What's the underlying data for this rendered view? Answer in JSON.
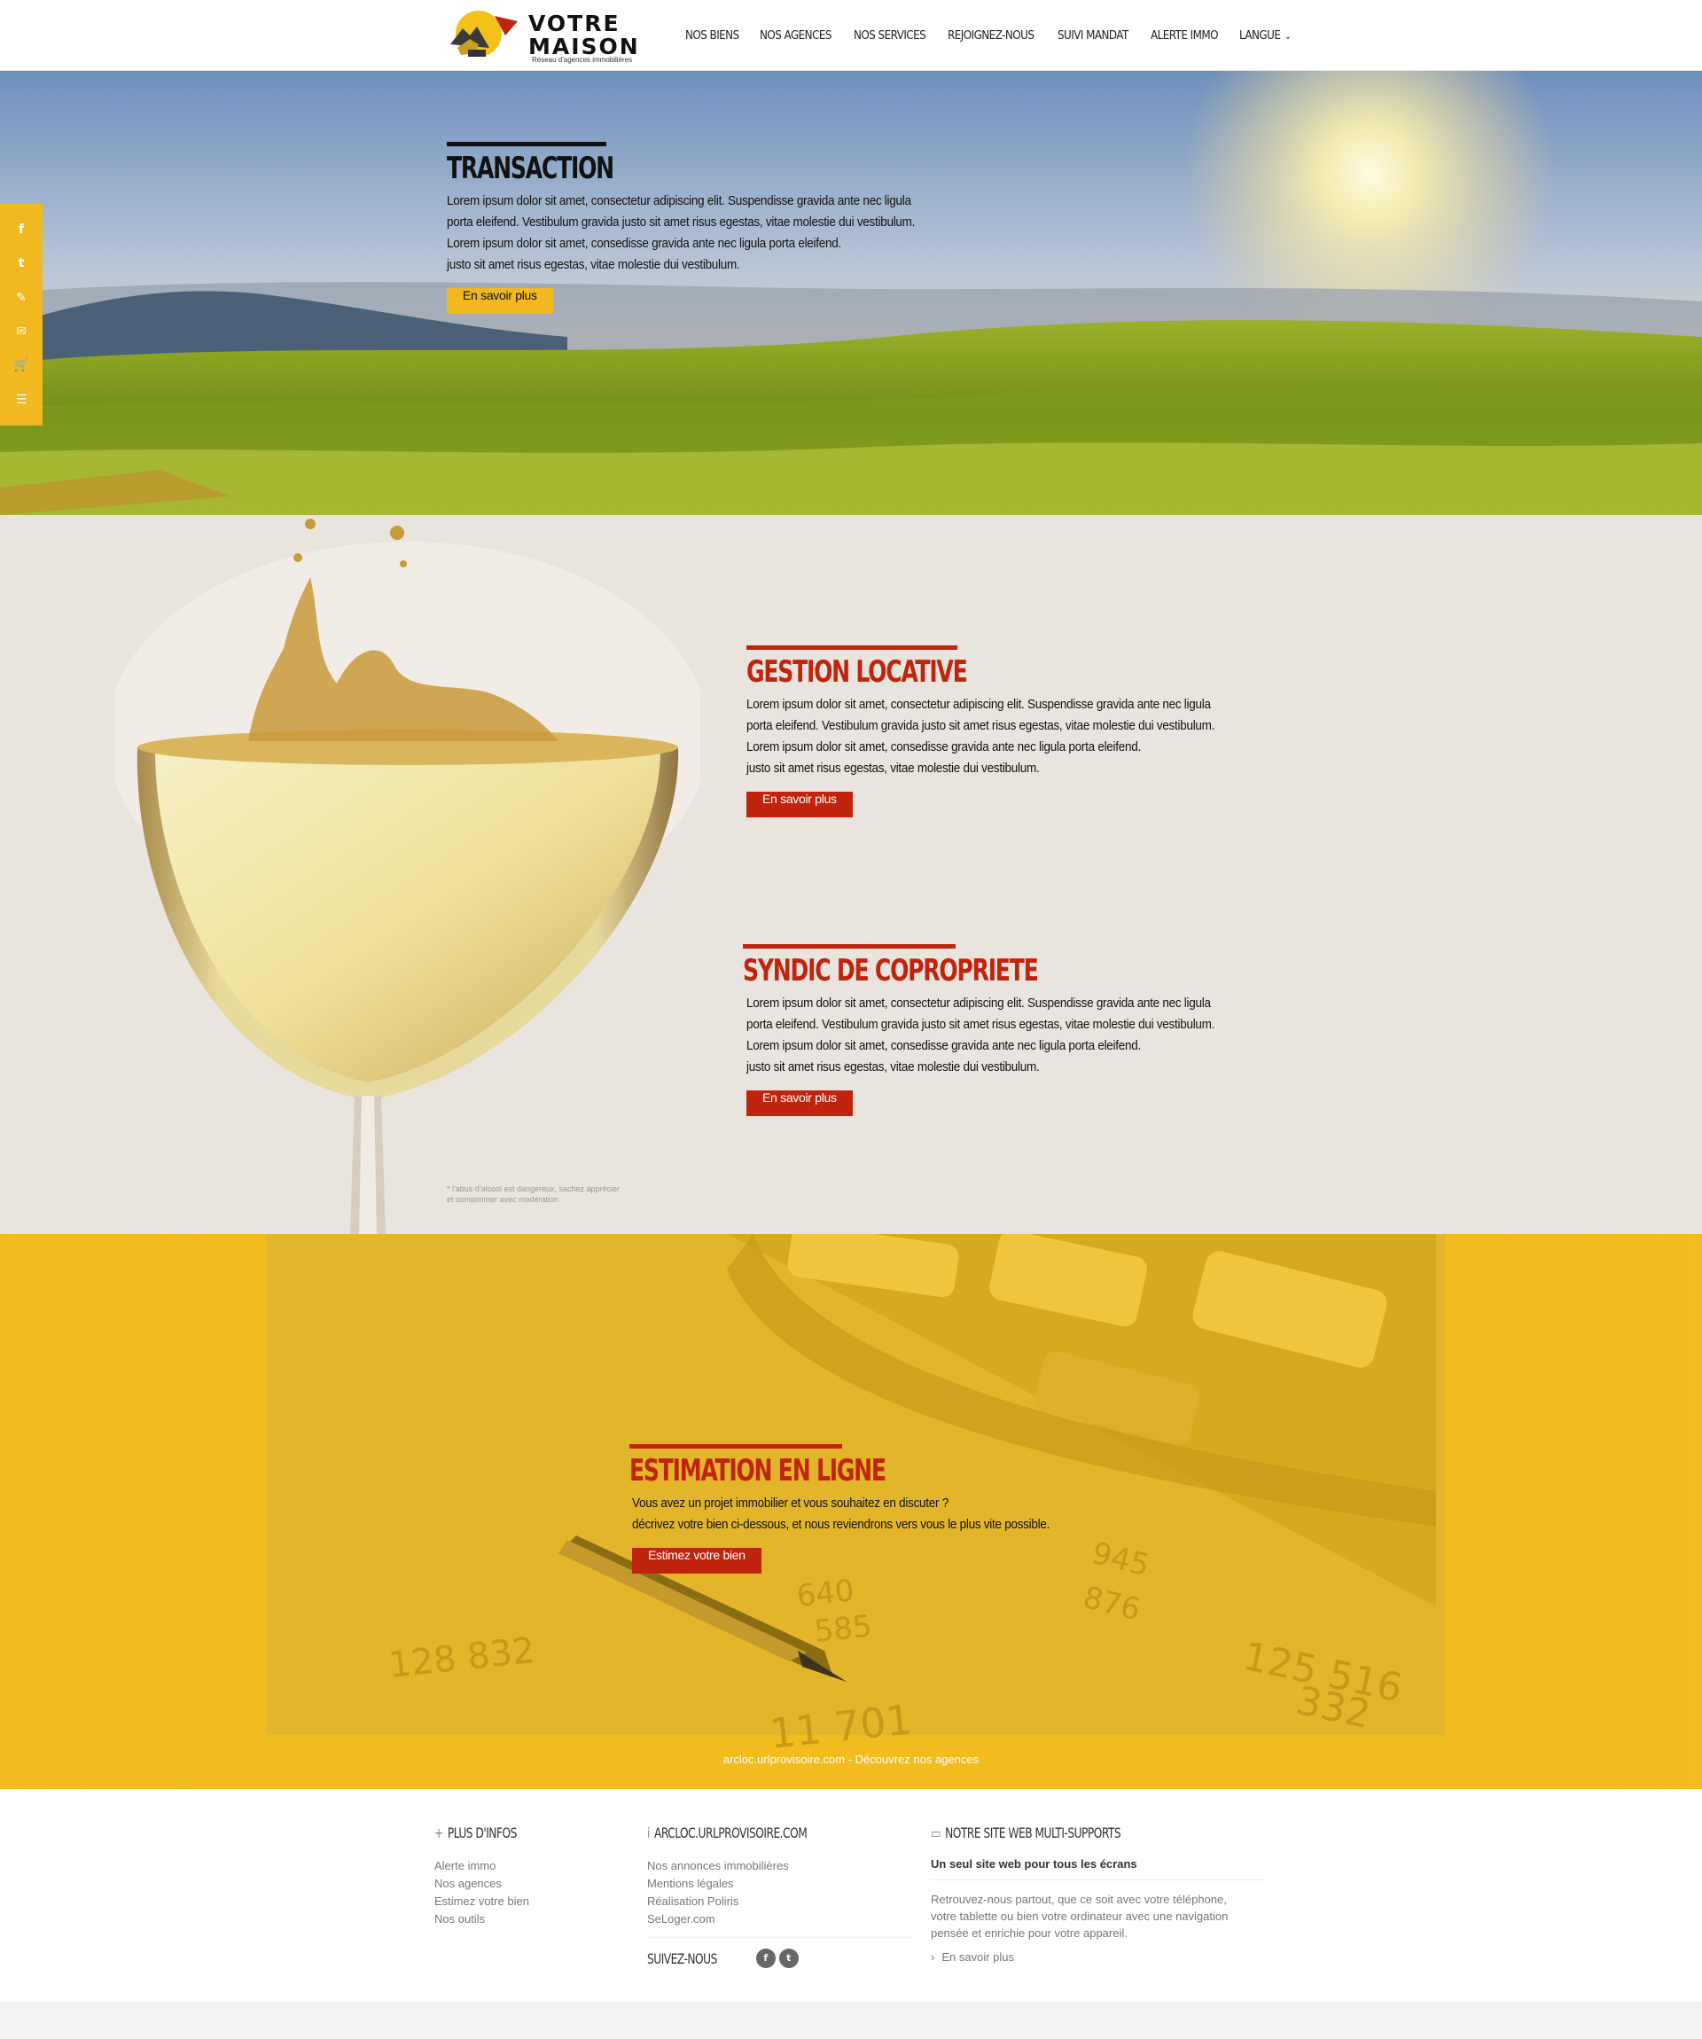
{
  "header": {
    "logo": {
      "line1": "VOTRE",
      "line2": "MAISON",
      "tagline": "Réseau d'agences immobilières"
    },
    "nav": [
      "NOS BIENS",
      "NOS AGENCES",
      "NOS SERVICES",
      "REJOIGNEZ-NOUS",
      "SUIVI MANDAT",
      "ALERTE IMMO",
      "LANGUE"
    ]
  },
  "social": [
    "f",
    "t",
    "✎",
    "✉",
    "🛒",
    "☰"
  ],
  "hero": {
    "title": "TRANSACTION",
    "text": "Lorem ipsum dolor sit amet, consectetur adipiscing elit. Suspendisse gravida ante nec ligula\nporta eleifend. Vestibulum gravida justo sit amet risus egestas, vitae molestie dui vestibulum.\nLorem ipsum dolor sit amet, consedisse gravida ante nec ligula porta eleifend.\njusto sit amet risus egestas, vitae molestie dui vestibulum.",
    "button": "En savoir plus",
    "accent": "#f2b820"
  },
  "wine": {
    "disclaimer": "* l'abus d'alcool est dangereux, sachez apprécier\net consommer avec modération",
    "gestion": {
      "title": "GESTION LOCATIVE",
      "text": "Lorem ipsum dolor sit amet, consectetur adipiscing elit. Suspendisse gravida ante nec ligula\nporta eleifend. Vestibulum gravida justo sit amet risus egestas, vitae molestie dui vestibulum.\nLorem ipsum dolor sit amet, consedisse gravida ante nec ligula porta eleifend.\njusto sit amet risus egestas, vitae molestie dui vestibulum.",
      "button": "En savoir plus"
    },
    "syndic": {
      "title": "SYNDIC DE COPROPRIETE",
      "text": "Lorem ipsum dolor sit amet, consectetur adipiscing elit. Suspendisse gravida ante nec ligula\nporta eleifend. Vestibulum gravida justo sit amet risus egestas, vitae molestie dui vestibulum.\nLorem ipsum dolor sit amet, consedisse gravida ante nec ligula porta eleifend.\njusto sit amet risus egestas, vitae molestie dui vestibulum.",
      "button": "En savoir plus"
    },
    "accent": "#c1240d"
  },
  "estimation": {
    "title": "ESTIMATION EN LIGNE",
    "text": "Vous avez un projet immobilier et vous souhaitez en discuter ?\ndécrivez votre bien ci-dessous, et nous reviendrons vers vous le plus vite possible.",
    "button": "Estimez votre bien",
    "footer_line": "arcloc.urlprovisoire.com - Découvrez nos agences",
    "background": "#f2bc1f"
  },
  "footer": {
    "col1": {
      "heading": "PLUS D'INFOS",
      "links": [
        "Alerte immo",
        "Nos agences",
        "Estimez votre bien",
        "Nos outils"
      ]
    },
    "col2": {
      "heading": "ARCLOC.URLPROVISOIRE.COM",
      "links": [
        "Nos annonces immobilières",
        "Mentions légales",
        "Réalisation Poliris",
        "SeLoger.com"
      ],
      "follow": "SUIVEZ-NOUS"
    },
    "col3": {
      "heading": "NOTRE SITE WEB MULTI-SUPPORTS",
      "subheading": "Un seul site web pour tous les écrans",
      "text": "Retrouvez-nous partout, que ce soit avec votre téléphone,\nvotre tablette ou bien votre ordinateur avec une navigation\npensée et enrichie pour votre appareil.",
      "link": "En savoir plus"
    }
  }
}
